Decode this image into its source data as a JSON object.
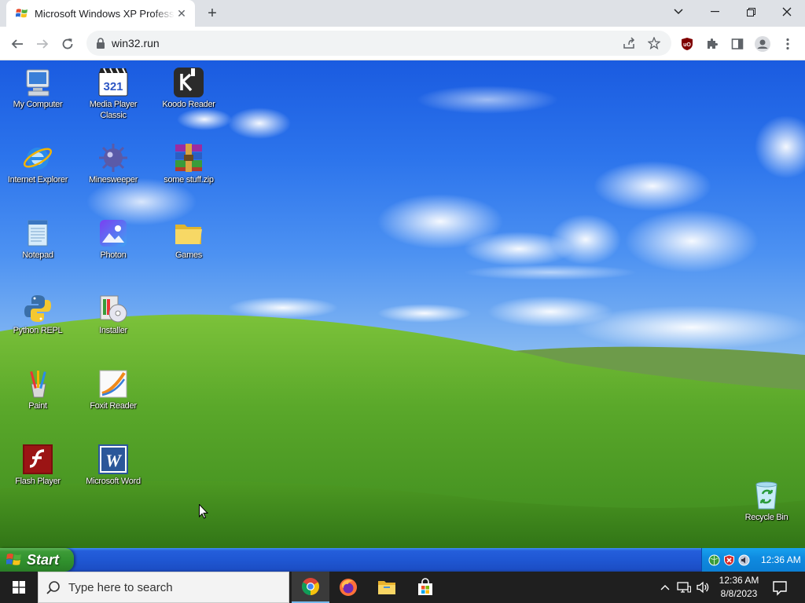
{
  "browser": {
    "tab_title": "Microsoft Windows XP Professional",
    "url": "win32.run"
  },
  "desktop": {
    "icons": [
      {
        "label": "My Computer",
        "icon": "computer-icon"
      },
      {
        "label": "Internet Explorer",
        "icon": "ie-icon"
      },
      {
        "label": "Notepad",
        "icon": "notepad-icon"
      },
      {
        "label": "Python REPL",
        "icon": "python-icon"
      },
      {
        "label": "Paint",
        "icon": "paint-icon"
      },
      {
        "label": "Flash Player",
        "icon": "flash-icon"
      },
      {
        "label": "Media Player Classic",
        "icon": "mpc-icon"
      },
      {
        "label": "Minesweeper",
        "icon": "minesweeper-icon"
      },
      {
        "label": "Photon",
        "icon": "photon-icon"
      },
      {
        "label": "Installer",
        "icon": "installer-icon"
      },
      {
        "label": "Foxit Reader",
        "icon": "foxit-icon"
      },
      {
        "label": "Microsoft Word",
        "icon": "word-icon"
      },
      {
        "label": "Koodo Reader",
        "icon": "koodo-icon"
      },
      {
        "label": "some stuff.zip",
        "icon": "zip-icon"
      },
      {
        "label": "Games",
        "icon": "folder-icon"
      },
      {
        "label": "Recycle Bin",
        "icon": "recycle-bin-icon"
      }
    ]
  },
  "xp_taskbar": {
    "start_label": "Start",
    "clock": "12:36 AM"
  },
  "win10_taskbar": {
    "search_placeholder": "Type here to search",
    "time": "12:36 AM",
    "date": "8/8/2023"
  },
  "colors": {
    "xp_taskbar_blue": "#245edb",
    "xp_start_green": "#3c9b37",
    "xp_tray_blue": "#0f8be0",
    "win10_taskbar": "#1f1f1f"
  }
}
